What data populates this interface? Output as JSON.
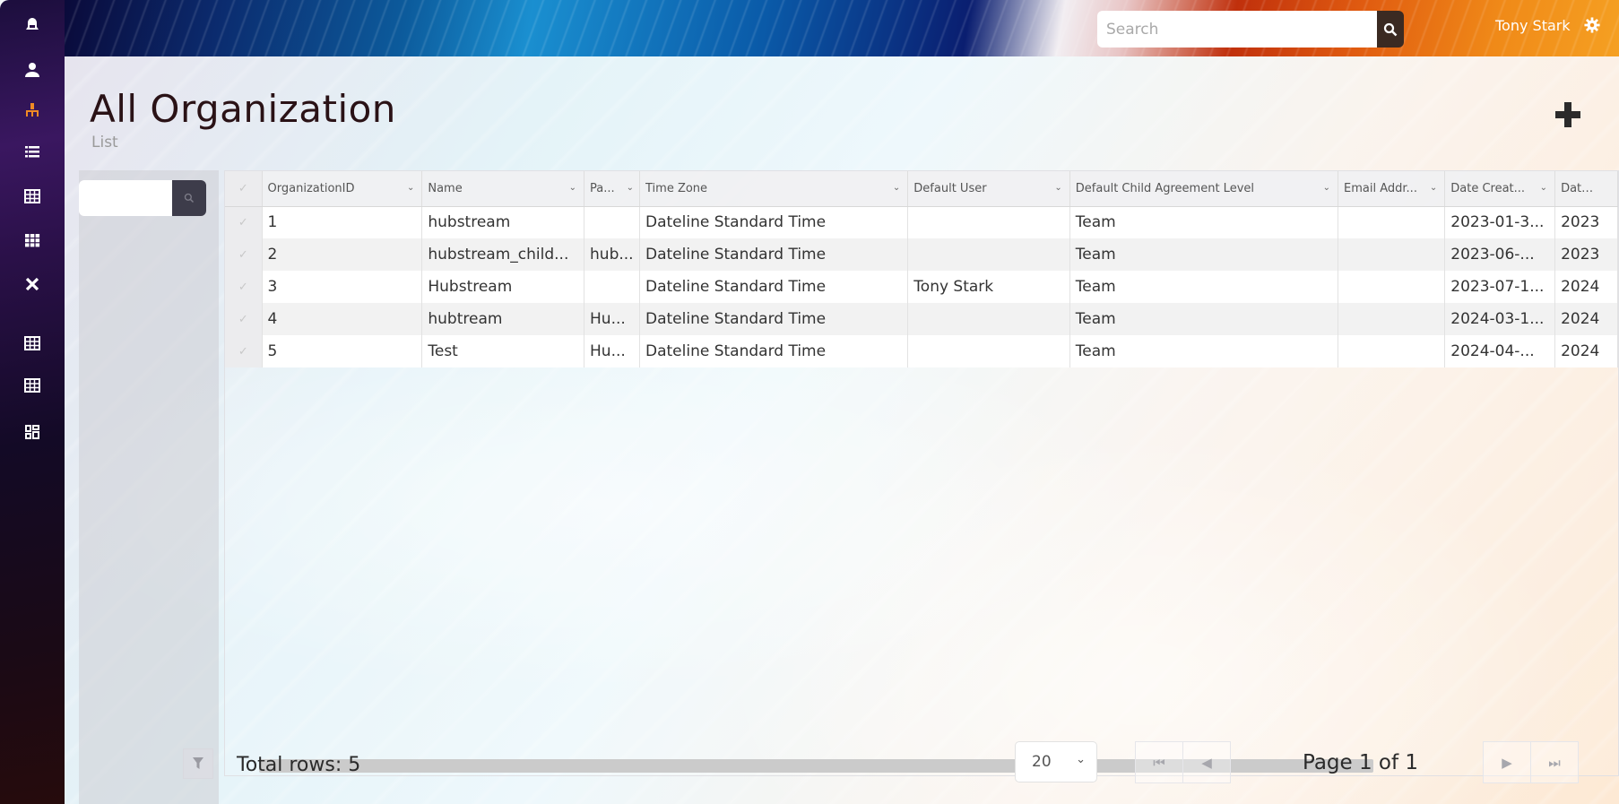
{
  "sidebar": {
    "items": [
      {
        "icon": "bell-icon",
        "label": "Notifications",
        "color": "#ffffff"
      },
      {
        "icon": "user-icon",
        "label": "Users",
        "color": "#ffffff"
      },
      {
        "icon": "org-chart-icon",
        "label": "Organizations",
        "color": "#f08a24",
        "active": true
      },
      {
        "icon": "list-icon",
        "label": "List",
        "color": "#ffffff"
      },
      {
        "icon": "table-icon",
        "label": "Table",
        "color": "#ffffff"
      },
      {
        "icon": "grid-icon",
        "label": "Grid",
        "color": "#ffffff"
      },
      {
        "icon": "close-icon",
        "label": "Close",
        "color": "#ffffff"
      },
      {
        "icon": "table-icon",
        "label": "Table 2",
        "color": "#ffffff"
      },
      {
        "icon": "table-icon",
        "label": "Table 3",
        "color": "#ffffff"
      },
      {
        "icon": "dashboard-icon",
        "label": "Dashboard",
        "color": "#ffffff"
      }
    ]
  },
  "header": {
    "search_placeholder": "Search",
    "search_value": "",
    "user_name": "Tony Stark"
  },
  "page": {
    "title": "All Organization",
    "subtitle": "List"
  },
  "filter": {
    "placeholder": "",
    "value": ""
  },
  "grid": {
    "columns": [
      {
        "label": "OrganizationID"
      },
      {
        "label": "Name"
      },
      {
        "label": "Pa..."
      },
      {
        "label": "Time Zone"
      },
      {
        "label": "Default User"
      },
      {
        "label": "Default Child Agreement Level"
      },
      {
        "label": "Email Addr..."
      },
      {
        "label": "Date Creat..."
      },
      {
        "label": "Date Up"
      }
    ],
    "rows": [
      {
        "id": "1",
        "name": "hubstream",
        "parent": "",
        "time_zone": "Dateline Standard Time",
        "default_user": "",
        "agreement_level": "Team",
        "email": "",
        "date_created": "2023-01-3...",
        "date_updated": "2023"
      },
      {
        "id": "2",
        "name": "hubstream_child...",
        "parent": "hub...",
        "time_zone": "Dateline Standard Time",
        "default_user": "",
        "agreement_level": "Team",
        "email": "",
        "date_created": "2023-06-...",
        "date_updated": "2023"
      },
      {
        "id": "3",
        "name": "Hubstream",
        "parent": "",
        "time_zone": "Dateline Standard Time",
        "default_user": "Tony Stark",
        "agreement_level": "Team",
        "email": "",
        "date_created": "2023-07-1...",
        "date_updated": "2024"
      },
      {
        "id": "4",
        "name": "hubtream",
        "parent": "Hu...",
        "time_zone": "Dateline Standard Time",
        "default_user": "",
        "agreement_level": "Team",
        "email": "",
        "date_created": "2024-03-1...",
        "date_updated": "2024"
      },
      {
        "id": "5",
        "name": "Test",
        "parent": "Hu...",
        "time_zone": "Dateline Standard Time",
        "default_user": "",
        "agreement_level": "Team",
        "email": "",
        "date_created": "2024-04-...",
        "date_updated": "2024"
      }
    ]
  },
  "footer": {
    "total_rows": "Total rows: 5",
    "page_size": "20",
    "page_info": "Page 1 of 1"
  },
  "colors": {
    "accent": "#f08a24",
    "search_button": "#3b2a22",
    "filter_button": "#3d3c4a",
    "title": "#2a1216"
  }
}
